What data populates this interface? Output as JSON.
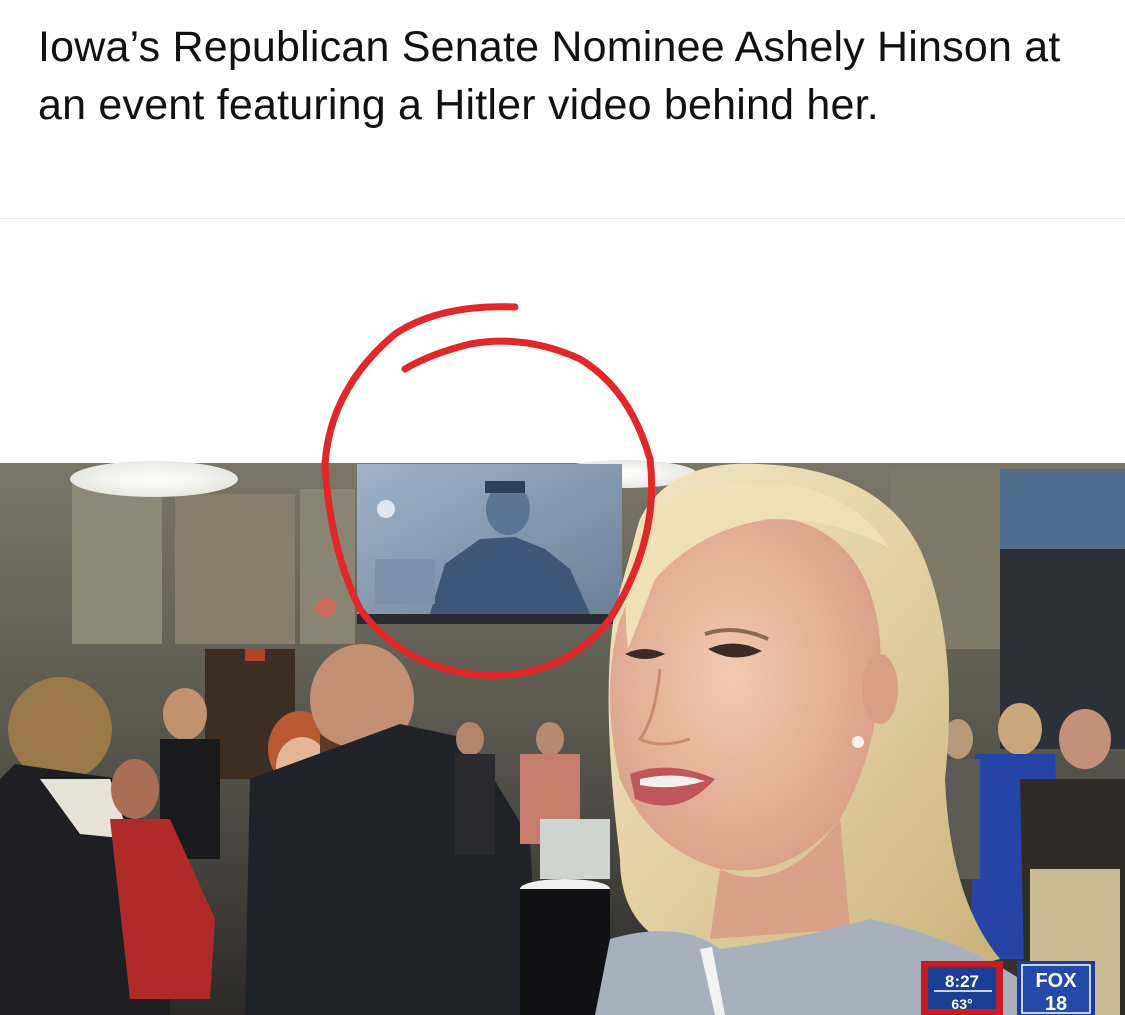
{
  "post": {
    "caption": "Iowa’s Republican Senate Nominee Ashely Hinson at an event featuring a Hitler video behind her."
  },
  "broadcast": {
    "time": "8:27",
    "temperature": "63°",
    "logo_brand": "FOX",
    "logo_channel": "18"
  },
  "colors": {
    "annotation_circle": "#e0282a",
    "ticker_bg": "#c61d23",
    "logo_bg": "#1b3f94"
  }
}
